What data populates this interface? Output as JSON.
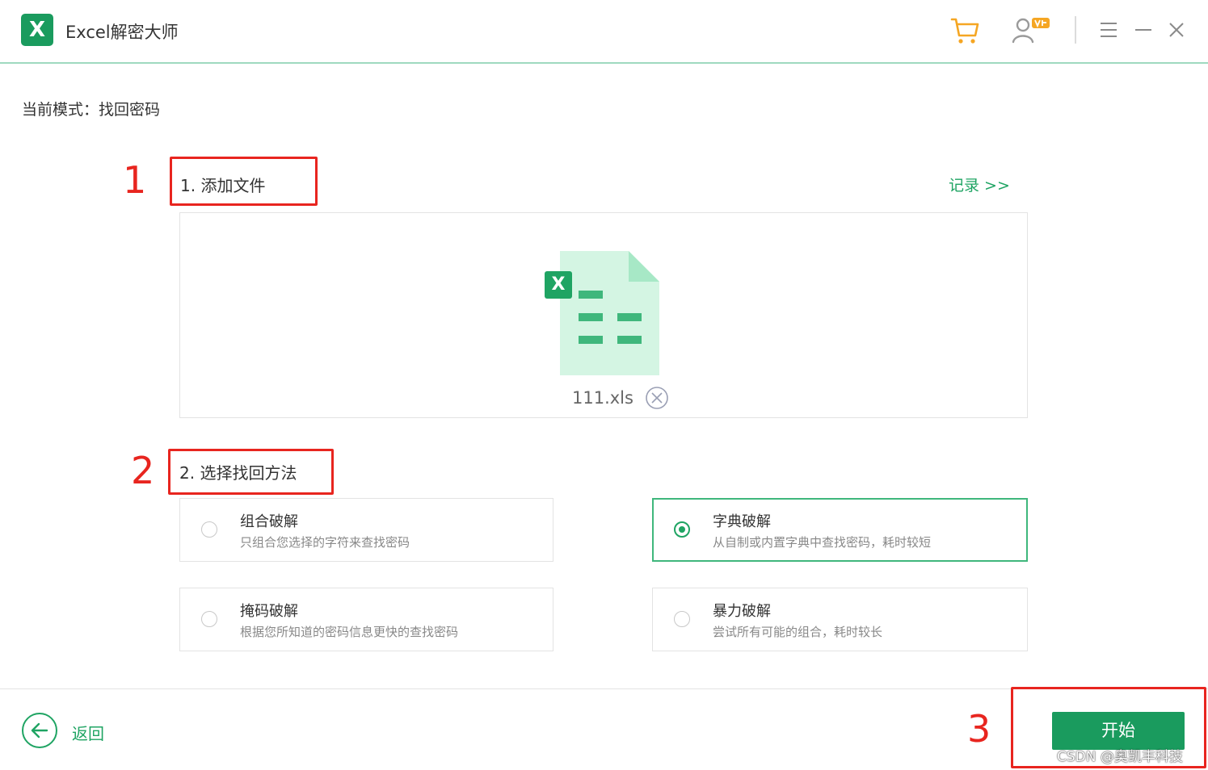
{
  "app": {
    "logo_letter": "X",
    "title": "Excel解密大师",
    "accent_color": "#1a9b5e",
    "annotation_color": "#e8251f"
  },
  "titlebar": {
    "icons": [
      "cart-icon",
      "user-vip-icon",
      "menu-icon",
      "minimize-icon",
      "close-icon"
    ]
  },
  "mode": {
    "label": "当前模式：找回密码"
  },
  "step1": {
    "number": "1",
    "title": "1. 添加文件",
    "record_link": "记录 >>",
    "file": {
      "icon_letter": "X",
      "name": "111.xls"
    }
  },
  "step2": {
    "number": "2",
    "title": "2. 选择找回方法",
    "methods": [
      {
        "title": "组合破解",
        "desc": "只组合您选择的字符来查找密码",
        "selected": false
      },
      {
        "title": "字典破解",
        "desc": "从自制或内置字典中查找密码，耗时较短",
        "selected": true
      },
      {
        "title": "掩码破解",
        "desc": "根据您所知道的密码信息更快的查找密码",
        "selected": false
      },
      {
        "title": "暴力破解",
        "desc": "尝试所有可能的组合，耗时较长",
        "selected": false
      }
    ]
  },
  "step3": {
    "number": "3"
  },
  "footer": {
    "back_label": "返回",
    "start_label": "开始",
    "watermark": "CSDN @奥凯丰科技"
  }
}
